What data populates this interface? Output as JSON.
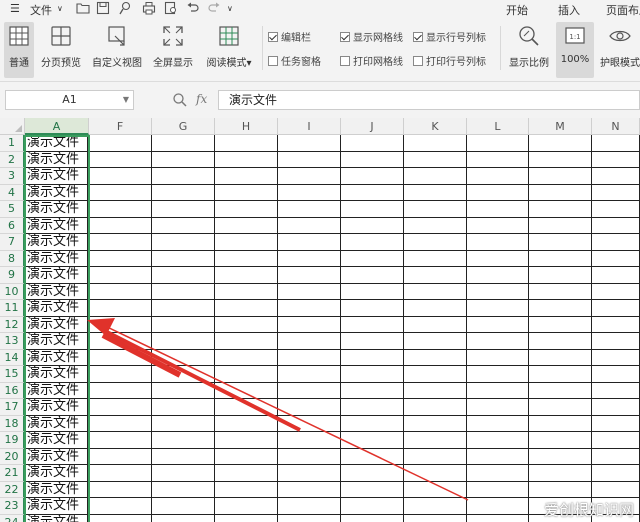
{
  "menubar": {
    "hamburger_icon": "menu-icon",
    "file_label": "文件",
    "tabs": [
      "开始",
      "插入",
      "页面布局"
    ]
  },
  "ribbon": {
    "buttons": [
      {
        "label": "普通",
        "icon": "normal-view-icon",
        "active": true
      },
      {
        "label": "分页预览",
        "icon": "page-break-preview-icon"
      },
      {
        "label": "自定义视图",
        "icon": "custom-view-icon"
      },
      {
        "label": "全屏显示",
        "icon": "fullscreen-icon"
      },
      {
        "label": "阅读模式",
        "icon": "reading-mode-icon"
      }
    ],
    "checkboxes": [
      {
        "label": "编辑栏",
        "checked": true
      },
      {
        "label": "任务窗格",
        "checked": false
      },
      {
        "label": "显示网格线",
        "checked": true
      },
      {
        "label": "打印网格线",
        "checked": false
      },
      {
        "label": "显示行号列标",
        "checked": true
      },
      {
        "label": "打印行号列标",
        "checked": false
      }
    ],
    "zoom_label": "显示比例",
    "zoom100_label": "100%",
    "eye_label": "护眼模式"
  },
  "formula_bar": {
    "name_box": "A1",
    "fx": "fx",
    "value": "演示文件"
  },
  "grid": {
    "columns": [
      "A",
      "F",
      "G",
      "H",
      "I",
      "J",
      "K",
      "L",
      "M",
      "N"
    ],
    "rows": [
      "1",
      "2",
      "3",
      "4",
      "5",
      "6",
      "7",
      "8",
      "9",
      "10",
      "11",
      "12",
      "13",
      "14",
      "15",
      "16",
      "17",
      "18",
      "19",
      "20",
      "21",
      "22",
      "23",
      "24"
    ],
    "cell_text": "演示文件"
  },
  "watermark": "爱创根知识网",
  "colors": {
    "selection": "#2e8b57",
    "arrow": "#e0322b"
  }
}
